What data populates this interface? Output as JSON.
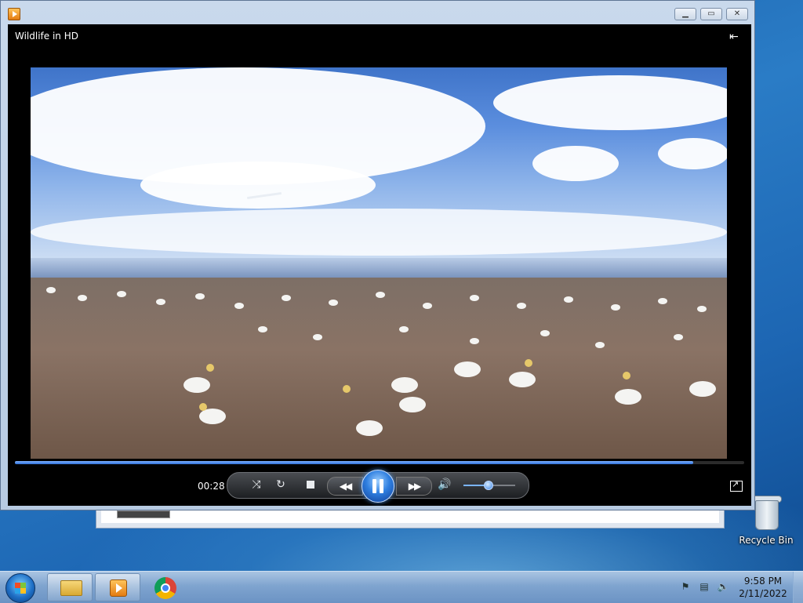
{
  "player": {
    "video_title": "Wildlife in HD",
    "elapsed_time": "00:28",
    "progress": 0.93,
    "volume": 0.5,
    "state": "playing",
    "icons": {
      "app": "media-player-icon",
      "switch_to_library": "switch-to-library-icon",
      "shuffle": "shuffle-icon",
      "repeat": "repeat-icon",
      "stop": "stop-icon",
      "previous": "previous-icon",
      "pause": "pause-icon",
      "next": "next-icon",
      "mute": "volume-icon",
      "fullscreen": "fullscreen-icon"
    }
  },
  "desktop": {
    "recycle_bin_label": "Recycle Bin"
  },
  "taskbar": {
    "time": "9:58 PM",
    "date": "2/11/2022",
    "pinned": [
      "File Explorer",
      "Windows Media Player",
      "Google Chrome"
    ]
  },
  "colors": {
    "accent": "#2f7fe0",
    "taskbar": "#7fa4cf",
    "player_bg": "#000000"
  }
}
